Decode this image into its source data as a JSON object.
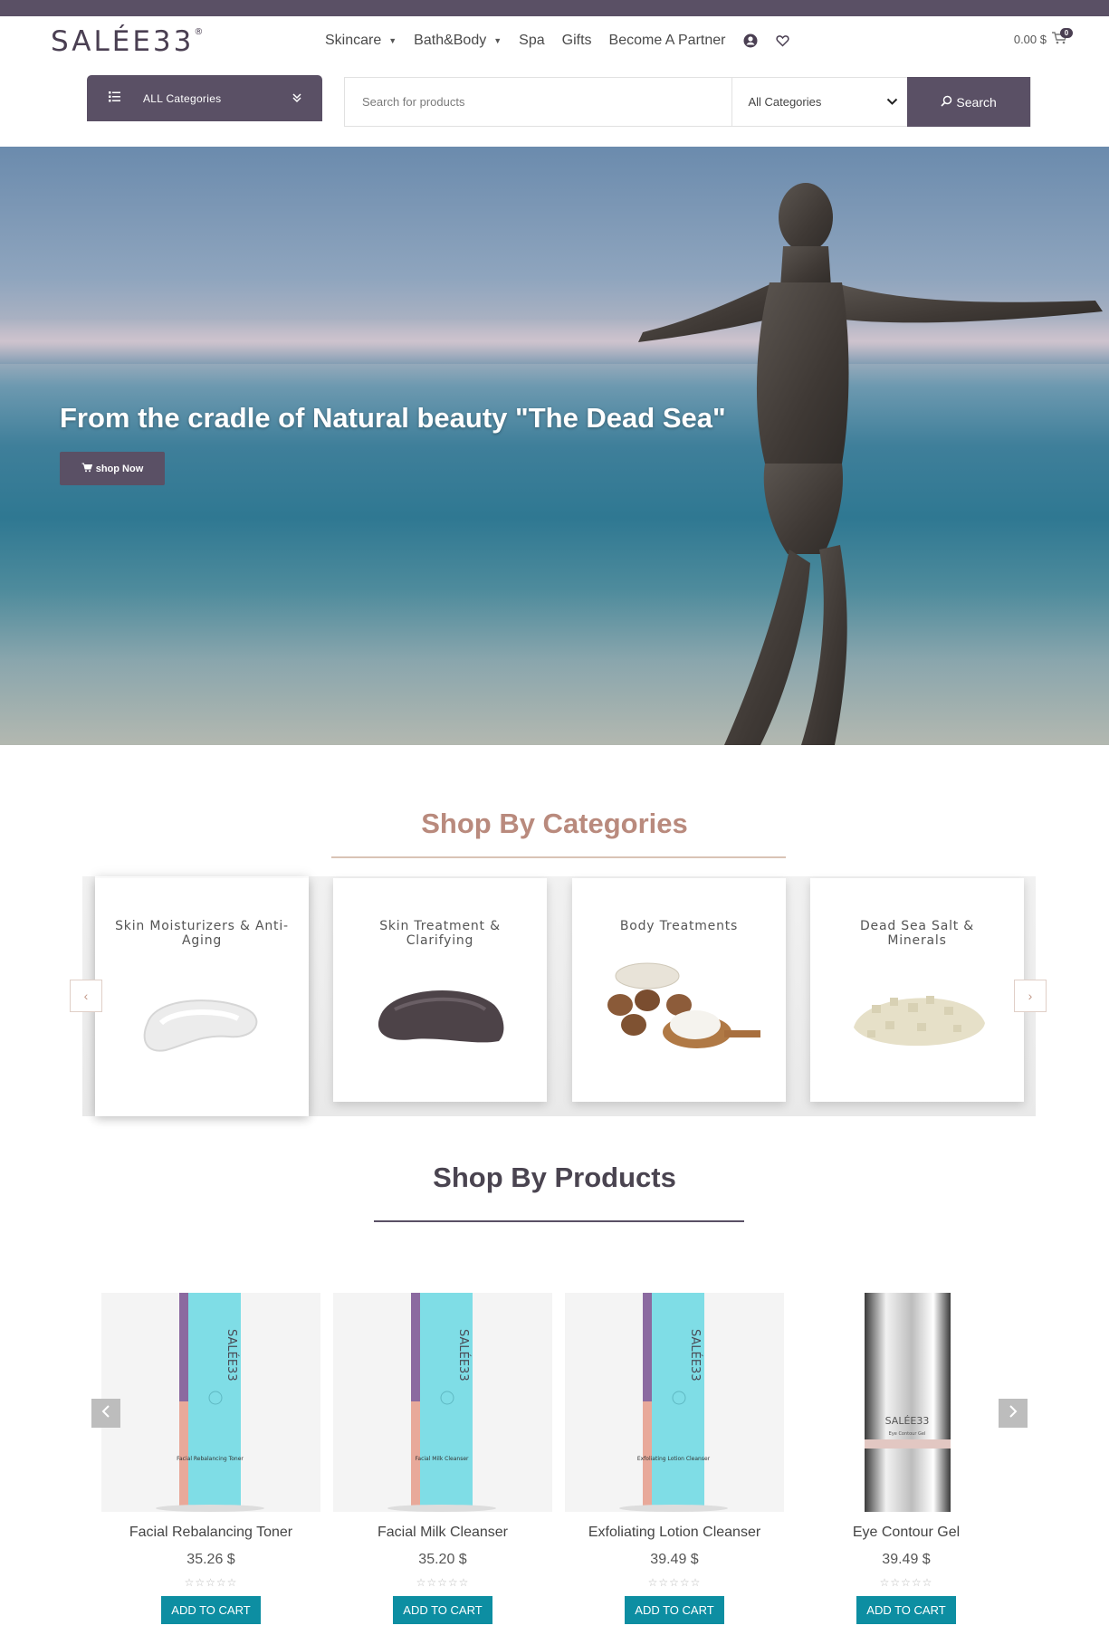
{
  "brand": {
    "logo_text": "SALÉE33",
    "logo_mark": "®"
  },
  "nav": {
    "items": [
      {
        "label": "Skincare",
        "dropdown": true
      },
      {
        "label": "Bath&Body",
        "dropdown": true
      },
      {
        "label": "Spa",
        "dropdown": false
      },
      {
        "label": "Gifts",
        "dropdown": false
      },
      {
        "label": "Become A Partner",
        "dropdown": false
      }
    ],
    "icons": [
      "user-icon",
      "heart-icon"
    ]
  },
  "cart": {
    "total": "0.00 $",
    "count": "0"
  },
  "category_menu": {
    "label": "ALL Categories"
  },
  "search": {
    "placeholder": "Search for products",
    "category_value": "All Categories",
    "button_label": "Search"
  },
  "hero": {
    "headline": "From the cradle of Natural beauty \"The Dead Sea\"",
    "button_label": "shop Now"
  },
  "shop_by_categories": {
    "title": "Shop By Categories",
    "items": [
      {
        "name": "Skin Moisturizers & Anti-Aging",
        "image": "cream-swatch"
      },
      {
        "name": "Skin Treatment & Clarifying",
        "image": "mud-swatch"
      },
      {
        "name": "Body Treatments",
        "image": "shea-butter"
      },
      {
        "name": "Dead Sea Salt & Minerals",
        "image": "sea-salt"
      }
    ]
  },
  "shop_by_products": {
    "title": "Shop By Products",
    "add_to_cart_label": "ADD TO CART",
    "items": [
      {
        "name": "Facial Rebalancing Toner",
        "price": "35.26 $",
        "rating": 0,
        "box_text": "Facial Rebalancing Toner"
      },
      {
        "name": "Facial Milk Cleanser",
        "price": "35.20 $",
        "rating": 0,
        "box_text": "Facial Milk Cleanser"
      },
      {
        "name": "Exfoliating Lotion Cleanser",
        "price": "39.49 $",
        "rating": 0,
        "box_text": "Exfoliating Lotion Cleanser"
      },
      {
        "name": "Eye Contour Gel",
        "price": "39.49 $",
        "rating": 0,
        "box_text": "Eye Contour Gel"
      }
    ]
  },
  "colors": {
    "brand": "#5a5065",
    "accent": "#b98a7d",
    "cart_button": "#0d8ea2"
  }
}
